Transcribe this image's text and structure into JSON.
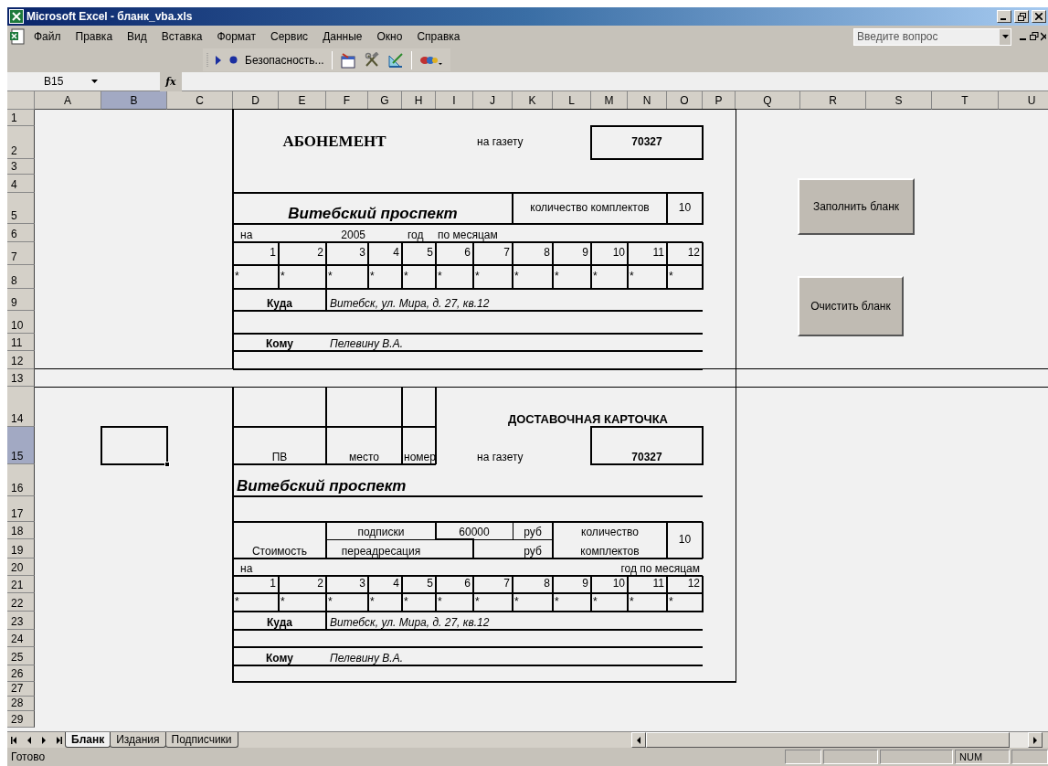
{
  "window": {
    "title": "Microsoft Excel - бланк_vba.xls"
  },
  "menu": [
    "Файл",
    "Правка",
    "Вид",
    "Вставка",
    "Формат",
    "Сервис",
    "Данные",
    "Окно",
    "Справка"
  ],
  "help_search": {
    "placeholder": "Введите вопрос"
  },
  "toolbar": {
    "security_button": "Безопасность..."
  },
  "formula_bar": {
    "name_box": "B15",
    "fx_label": "fx"
  },
  "columns": [
    {
      "label": "A",
      "selected": false
    },
    {
      "label": "B",
      "selected": true
    },
    {
      "label": "C",
      "selected": false
    },
    {
      "label": "D",
      "selected": false
    },
    {
      "label": "E",
      "selected": false
    },
    {
      "label": "F",
      "selected": false
    },
    {
      "label": "G",
      "selected": false
    },
    {
      "label": "H",
      "selected": false
    },
    {
      "label": "I",
      "selected": false
    },
    {
      "label": "J",
      "selected": false
    },
    {
      "label": "K",
      "selected": false
    },
    {
      "label": "L",
      "selected": false
    },
    {
      "label": "M",
      "selected": false
    },
    {
      "label": "N",
      "selected": false
    },
    {
      "label": "O",
      "selected": false
    },
    {
      "label": "P",
      "selected": false
    },
    {
      "label": "Q",
      "selected": false
    },
    {
      "label": "R",
      "selected": false
    },
    {
      "label": "S",
      "selected": false
    },
    {
      "label": "T",
      "selected": false
    },
    {
      "label": "U",
      "selected": false
    }
  ],
  "rows": [
    {
      "label": "1",
      "selected": false
    },
    {
      "label": "2",
      "selected": false
    },
    {
      "label": "3",
      "selected": false
    },
    {
      "label": "4",
      "selected": false
    },
    {
      "label": "5",
      "selected": false
    },
    {
      "label": "6",
      "selected": false
    },
    {
      "label": "7",
      "selected": false
    },
    {
      "label": "8",
      "selected": false
    },
    {
      "label": "9",
      "selected": false
    },
    {
      "label": "10",
      "selected": false
    },
    {
      "label": "11",
      "selected": false
    },
    {
      "label": "12",
      "selected": false
    },
    {
      "label": "13",
      "selected": false
    },
    {
      "label": "14",
      "selected": false
    },
    {
      "label": "15",
      "selected": true
    },
    {
      "label": "16",
      "selected": false
    },
    {
      "label": "17",
      "selected": false
    },
    {
      "label": "18",
      "selected": false
    },
    {
      "label": "19",
      "selected": false
    },
    {
      "label": "20",
      "selected": false
    },
    {
      "label": "21",
      "selected": false
    },
    {
      "label": "22",
      "selected": false
    },
    {
      "label": "23",
      "selected": false
    },
    {
      "label": "24",
      "selected": false
    },
    {
      "label": "25",
      "selected": false
    },
    {
      "label": "26",
      "selected": false
    },
    {
      "label": "27",
      "selected": false
    },
    {
      "label": "28",
      "selected": false
    },
    {
      "label": "29",
      "selected": false
    }
  ],
  "form": {
    "subscription": {
      "title": "АБОНЕМЕНТ",
      "newspaper_label": "на газету",
      "index": "70327",
      "destination": "Витебский проспект",
      "sets_label": "количество комплектов",
      "sets": "10",
      "year_prefix": "на",
      "year": "2005",
      "year_label": "год",
      "months_label": "по месяцам",
      "months": [
        "1",
        "2",
        "3",
        "4",
        "5",
        "6",
        "7",
        "8",
        "9",
        "10",
        "11",
        "12"
      ],
      "month_marks": [
        "*",
        "*",
        "*",
        "*",
        "*",
        "*",
        "*",
        "*",
        "*",
        "*",
        "*",
        "*"
      ],
      "address_label": "Куда",
      "address": "Витебск, ул. Мира, д. 27, кв.12",
      "recipient_label": "Кому",
      "recipient": "Пелевину В.А."
    },
    "delivery_card": {
      "pv_label": "ПВ",
      "place_label": "место",
      "number_label": "номер",
      "title": "ДОСТАВОЧНАЯ КАРТОЧКА",
      "newspaper_label": "на газету",
      "index": "70327",
      "destination": "Витебский проспект",
      "cost_label": "Стоимость",
      "subscription_label": "подписки",
      "subscription_cost": "60000",
      "currency_1": "руб",
      "readdress_label": "переадресация",
      "currency_2": "руб",
      "sets_label_1": "количество",
      "sets_label_2": "комплектов",
      "sets": "10",
      "year_prefix": "на",
      "year_label": "год по месяцам",
      "months": [
        "1",
        "2",
        "3",
        "4",
        "5",
        "6",
        "7",
        "8",
        "9",
        "10",
        "11",
        "12"
      ],
      "month_marks": [
        "*",
        "*",
        "*",
        "*",
        "*",
        "*",
        "*",
        "*",
        "*",
        "*",
        "*",
        "*"
      ],
      "address_label": "Куда",
      "address": "Витебск, ул. Мира, д. 27, кв.12",
      "recipient_label": "Кому",
      "recipient": "Пелевину В.А."
    }
  },
  "buttons": [
    {
      "label": "Заполнить бланк"
    },
    {
      "label": "Очистить бланк"
    }
  ],
  "sheet_tabs": [
    {
      "label": "Бланк",
      "selected": true
    },
    {
      "label": "Издания",
      "selected": false
    },
    {
      "label": "Подписчики",
      "selected": false
    }
  ],
  "status_bar": {
    "text": "Готово",
    "num": "NUM"
  }
}
